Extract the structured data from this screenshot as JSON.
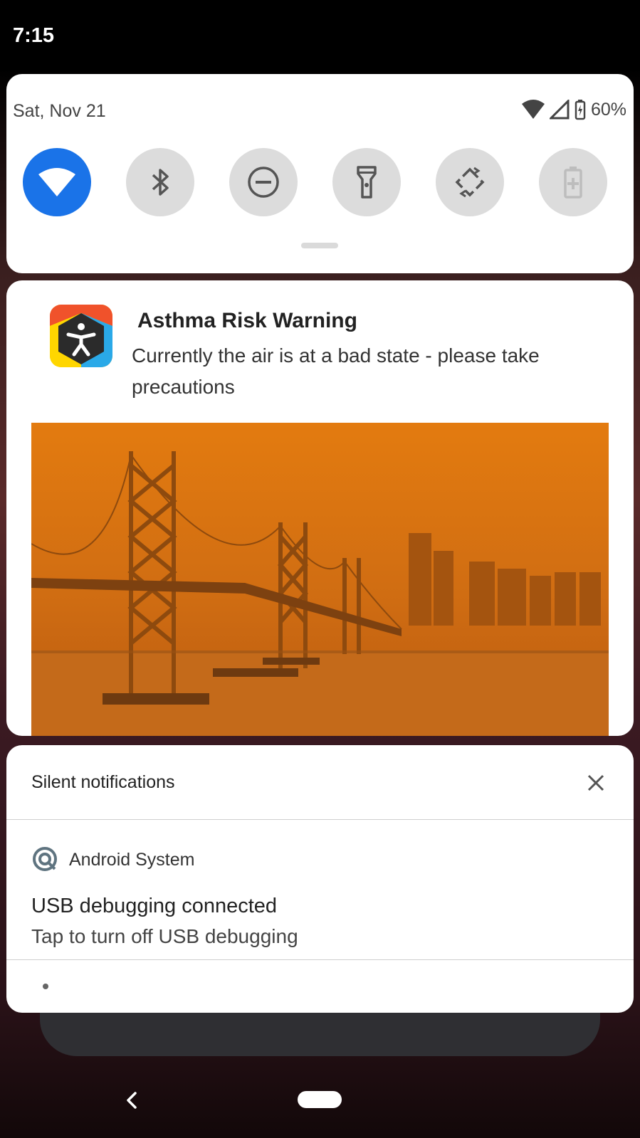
{
  "status_bar": {
    "time": "7:15"
  },
  "quick_settings": {
    "date": "Sat, Nov 21",
    "battery_percent": "60%",
    "tiles": [
      {
        "name": "wifi",
        "active": true
      },
      {
        "name": "bluetooth",
        "active": false
      },
      {
        "name": "do-not-disturb",
        "active": false
      },
      {
        "name": "flashlight",
        "active": false
      },
      {
        "name": "auto-rotate",
        "active": false
      },
      {
        "name": "battery-saver",
        "active": false
      }
    ]
  },
  "notification": {
    "title": "Asthma Risk Warning",
    "body": " Currently the air is at a bad state - please take precautions",
    "image_description_icon": "orange-haze-bridge-image"
  },
  "silent": {
    "header": "Silent notifications",
    "app_name": "Android System",
    "title": "USB debugging connected",
    "body": "Tap to turn off USB debugging"
  },
  "colors": {
    "accent": "#1a73e8",
    "tile_inactive": "#dcdcdc",
    "haze_orange": "#d97a1a"
  }
}
